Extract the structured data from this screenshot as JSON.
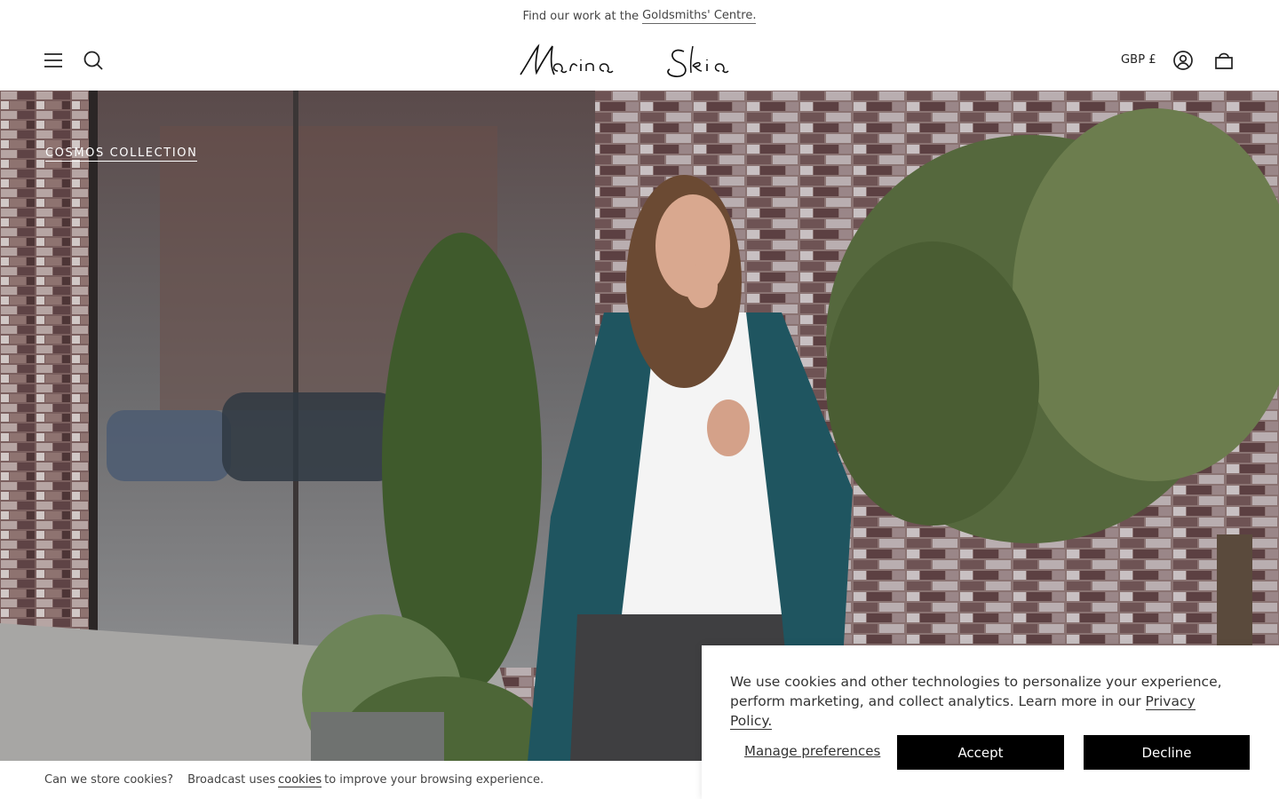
{
  "announcement": {
    "prefix": "Find our work at the",
    "link": "Goldsmiths' Centre."
  },
  "header": {
    "logo_text": "Marina Skia",
    "currency": "GBP £",
    "icons": [
      "menu-icon",
      "search-icon",
      "account-icon",
      "cart-icon"
    ]
  },
  "hero": {
    "collection_link": "COSMOS COLLECTION"
  },
  "cookie_bar": {
    "question": "Can we store cookies?",
    "text_before": "Broadcast uses",
    "link": "cookies",
    "text_after": "to improve your browsing experience."
  },
  "consent": {
    "message": "We use cookies and other technologies to personalize your experience, perform marketing, and collect analytics. Learn more in our",
    "privacy_link": "Privacy Policy.",
    "manage_label": "Manage preferences",
    "accept_label": "Accept",
    "decline_label": "Decline"
  },
  "colors": {
    "button_bg": "#000000",
    "button_text": "#ffffff",
    "coat_teal": "#1f5560"
  }
}
